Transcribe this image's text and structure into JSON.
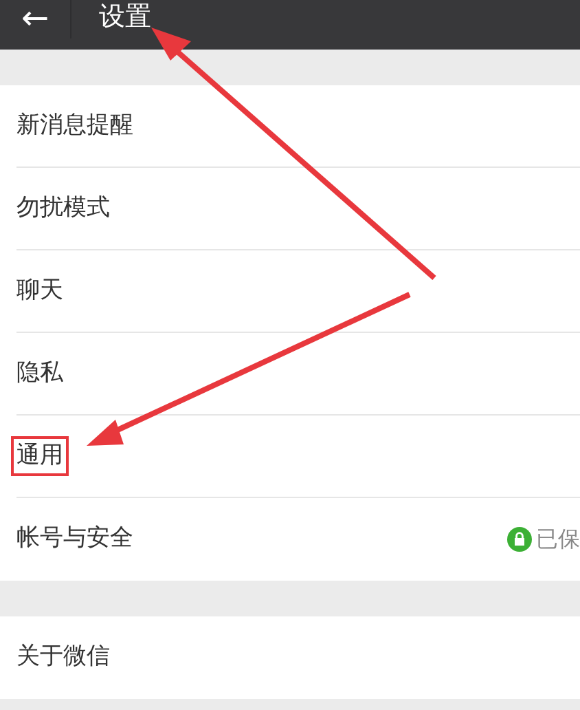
{
  "header": {
    "back": "←",
    "title": "设置"
  },
  "groups": [
    {
      "items": [
        {
          "label": "新消息提醒",
          "highlighted": false
        },
        {
          "label": "勿扰模式",
          "highlighted": false
        },
        {
          "label": "聊天",
          "highlighted": false
        },
        {
          "label": "隐私",
          "highlighted": false
        },
        {
          "label": "通用",
          "highlighted": true
        },
        {
          "label": "帐号与安全",
          "highlighted": false,
          "status": "已保"
        }
      ]
    },
    {
      "items": [
        {
          "label": "关于微信",
          "highlighted": false
        }
      ]
    }
  ]
}
